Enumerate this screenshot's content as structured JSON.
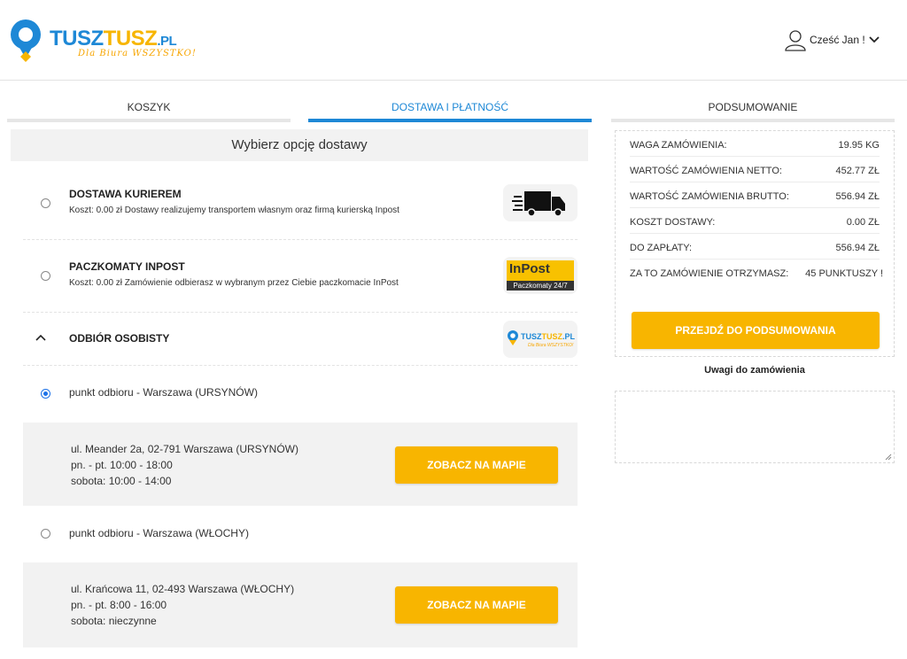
{
  "brand": {
    "name_part1": "TUSZ",
    "name_part2": "TUSZ",
    "domain": ".PL",
    "slogan": "Dla Biura WSZYSTKO!"
  },
  "user": {
    "greeting": "Cześć Jan !"
  },
  "steps": [
    {
      "label": "KOSZYK",
      "active": false
    },
    {
      "label": "DOSTAWA I PŁATNOŚĆ",
      "active": true
    },
    {
      "label": "PODSUMOWANIE",
      "active": false
    }
  ],
  "delivery": {
    "section_title": "Wybierz opcję dostawy",
    "options": [
      {
        "title": "DOSTAWA KURIEREM",
        "desc": "Koszt: 0.00 zł Dostawy realizujemy transportem własnym oraz firmą kurierską Inpost",
        "icon": "truck-icon",
        "selected": false
      },
      {
        "title": "PACZKOMATY INPOST",
        "desc": "Koszt: 0.00 zł Zamówienie odbierasz w wybranym przez Ciebie paczkomacie InPost",
        "icon": "inpost-logo",
        "logo_main": "InPost",
        "logo_sub": "Paczkomaty 24/7",
        "selected": false
      },
      {
        "title": "ODBIÓR OSOBISTY",
        "icon": "tusztusz-logo",
        "expanded": true,
        "logo_part1": "TUSZ",
        "logo_part2": "TUSZ",
        "logo_domain": ".PL",
        "logo_sub": "Dla Biura WSZYSTKO!"
      }
    ],
    "pickup_points": [
      {
        "label": "punkt odbioru - Warszawa (URSYNÓW)",
        "selected": true,
        "address": "ul. Meander 2a, 02-791 Warszawa (URSYNÓW)",
        "hours1": "pn. - pt. 10:00 - 18:00",
        "hours2": "sobota: 10:00 - 14:00",
        "map_button": "ZOBACZ NA MAPIE"
      },
      {
        "label": "punkt odbioru - Warszawa (WŁOCHY)",
        "selected": false,
        "address": "ul. Krańcowa 11, 02-493 Warszawa (WŁOCHY)",
        "hours1": "pn. - pt. 8:00 - 16:00",
        "hours2": "sobota: nieczynne",
        "map_button": "ZOBACZ NA MAPIE"
      }
    ]
  },
  "summary": {
    "rows": [
      {
        "label": "WAGA ZAMÓWIENIA:",
        "value": "19.95 KG"
      },
      {
        "label": "WARTOŚĆ ZAMÓWIENIA NETTO:",
        "value": "452.77 ZŁ"
      },
      {
        "label": "WARTOŚĆ ZAMÓWIENIA BRUTTO:",
        "value": "556.94 ZŁ"
      },
      {
        "label": "KOSZT DOSTAWY:",
        "value": "0.00 ZŁ"
      },
      {
        "label": "DO ZAPŁATY:",
        "value": "556.94 ZŁ"
      },
      {
        "label": "ZA TO ZAMÓWIENIE OTRZYMASZ:",
        "value": "45 PUNKTUSZY !"
      }
    ],
    "cta": "PRZEJDŹ DO PODSUMOWANIA"
  },
  "notes": {
    "label": "Uwagi do zamówienia",
    "value": ""
  },
  "colors": {
    "accent_blue": "#1e88d6",
    "accent_yellow": "#f8b500"
  }
}
